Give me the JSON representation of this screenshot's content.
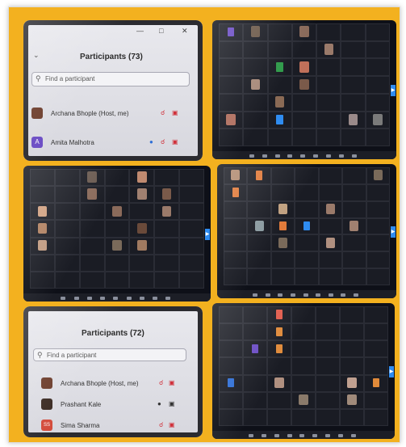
{
  "panel_top": {
    "title": "Participants (73)",
    "search_placeholder": "Find a participant",
    "rows": [
      {
        "name": "Archana Bhople (Host, me)",
        "avatar_color": "#6b3b2a"
      },
      {
        "name": "Amita Malhotra",
        "avatar_letter": "A",
        "avatar_color": "#6a4bc4"
      }
    ]
  },
  "panel_bottom": {
    "title": "Participants (72)",
    "search_placeholder": "Find a participant",
    "rows": [
      {
        "name": "Archana Bhople (Host, me)",
        "avatar_color": "#6b3b2a"
      },
      {
        "name": "Prashant Kale",
        "avatar_color": "#3a2a22"
      },
      {
        "name": "Sima Sharma",
        "avatar_letter": "SS",
        "avatar_color": "#d34b3b"
      }
    ]
  },
  "colors": {
    "frame_bg": "#f3b11f",
    "accent_blue": "#2f8cf0",
    "gallery_bg": "#0e1018"
  },
  "icons": [
    "search-icon",
    "minimize-icon",
    "close-icon",
    "chevron-down-icon",
    "mic-off-icon",
    "video-off-icon"
  ]
}
